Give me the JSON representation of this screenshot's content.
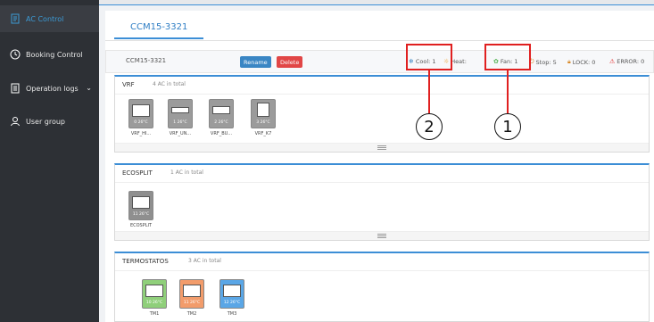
{
  "sidebar": {
    "items": [
      {
        "label": "AC Control",
        "icon": "document-icon",
        "active": true
      },
      {
        "label": "Booking Control",
        "icon": "clock-icon"
      },
      {
        "label": "Operation logs",
        "icon": "document-icon"
      },
      {
        "label": "User group",
        "icon": "user-icon"
      }
    ]
  },
  "tab": {
    "label": "CCM15-3321"
  },
  "info": {
    "name": "CCM15-3321",
    "rename_label": "Rename",
    "delete_label": "Delete",
    "cool": "Cool: 1",
    "heat": "Heat:",
    "fan": "Fan: 1",
    "stop": "Stop: 5",
    "lock": "LOCK: 0",
    "error": "ERROR: 0"
  },
  "groups": [
    {
      "title": "VRF",
      "count": "4 AC in total",
      "devices": [
        {
          "label": "VRF_HI...",
          "temps": "0  26°C"
        },
        {
          "label": "VRF_UN...",
          "temps": "1  26°C"
        },
        {
          "label": "VRF_BU...",
          "temps": "2  26°C"
        },
        {
          "label": "VRF_K7",
          "temps": "3  26°C"
        }
      ]
    },
    {
      "title": "ECOSPLIT",
      "count": "1 AC in total",
      "devices": [
        {
          "label": "ECOSPLIT",
          "temps": "11  26°C"
        }
      ]
    },
    {
      "title": "TERMOSTATOS",
      "count": "3 AC in total",
      "devices": [
        {
          "label": "TM1",
          "temps": "10  26°C"
        },
        {
          "label": "TM2",
          "temps": "11  26°C"
        },
        {
          "label": "TM3",
          "temps": "12  26°C"
        }
      ]
    }
  ],
  "annotations": {
    "callout_1": "1",
    "callout_2": "2"
  },
  "colors": {
    "accent": "#3c8ed6",
    "callout": "#e02020",
    "vrf": "#9b9b9b",
    "eco": "#8f8f8f",
    "tm1": "#8fcf7a",
    "tm2": "#f29c6b",
    "tm3": "#5aa6e6"
  }
}
